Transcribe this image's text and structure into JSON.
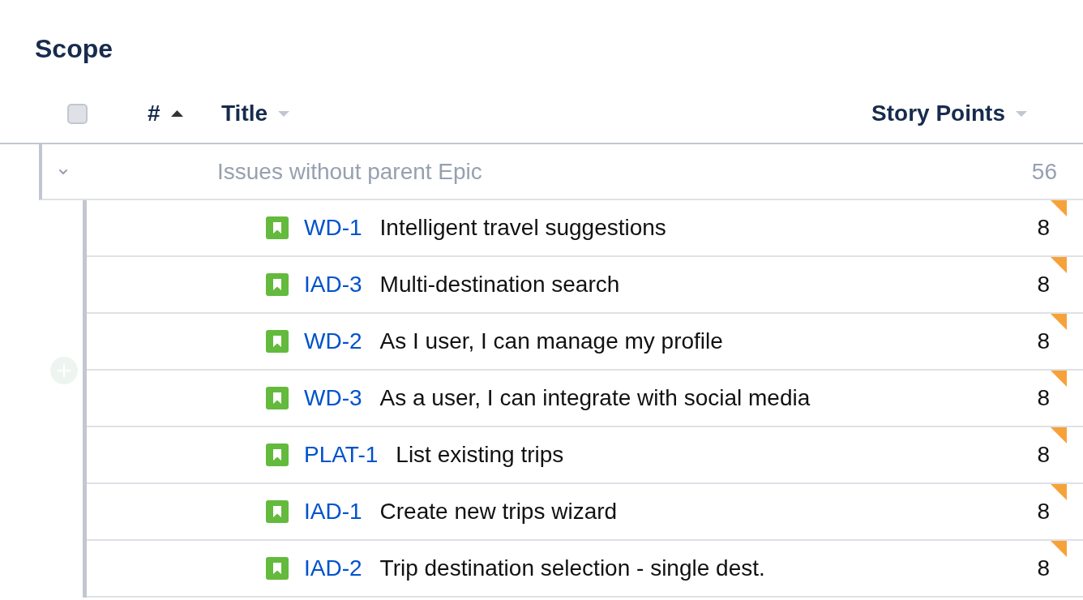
{
  "title": "Scope",
  "table": {
    "select_all": {
      "checked": false
    },
    "columns": [
      {
        "label": "#",
        "sorted": true,
        "ascending": true
      },
      {
        "label": "Title",
        "sorted": false
      },
      {
        "label": "Story Points",
        "sorted": false
      }
    ],
    "groups": [
      {
        "title": "Issues without parent Epic",
        "story_points": "56",
        "expanded": true,
        "children": [
          {
            "key": "WD-1",
            "title": "Intelligent travel suggestions",
            "story_points": "8",
            "changed": true
          },
          {
            "key": "IAD-3",
            "title": "Multi-destination search",
            "story_points": "8",
            "changed": true
          },
          {
            "key": "WD-2",
            "title": "As I user, I can manage my profile",
            "story_points": "8",
            "changed": true
          },
          {
            "key": "WD-3",
            "title": "As a user, I can integrate with social media",
            "story_points": "8",
            "changed": true
          },
          {
            "key": "PLAT-1",
            "title": "List existing trips",
            "story_points": "8",
            "changed": true
          },
          {
            "key": "IAD-1",
            "title": "Create new trips wizard",
            "story_points": "8",
            "changed": true
          },
          {
            "key": "IAD-2",
            "title": "Trip destination selection - single dest.",
            "story_points": "8",
            "changed": true
          }
        ]
      }
    ]
  }
}
